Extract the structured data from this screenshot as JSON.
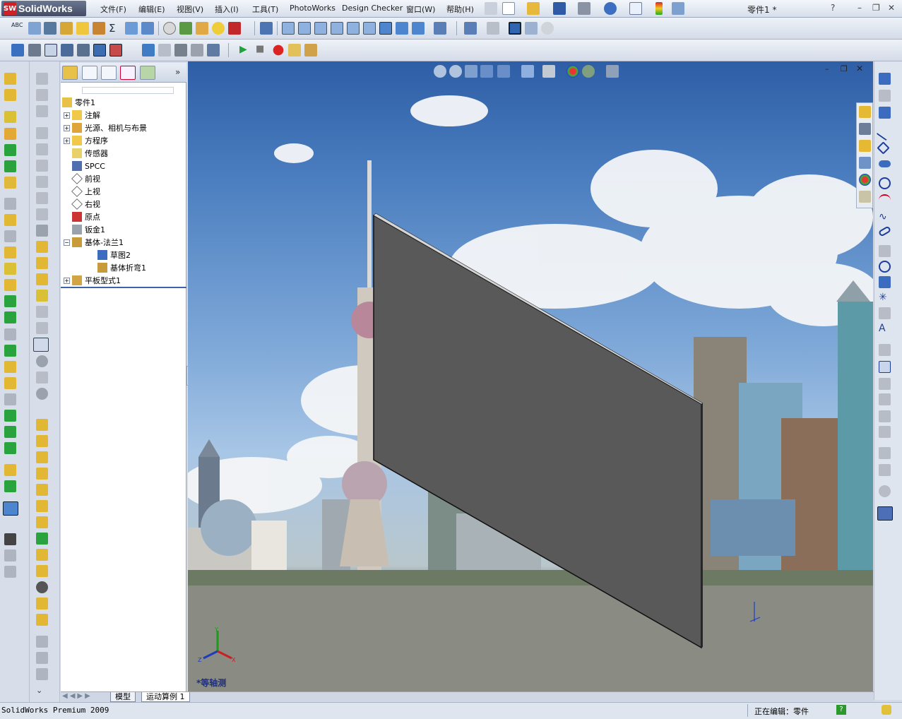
{
  "app": {
    "logo_mark": "SW",
    "logo_text": "SolidWorks"
  },
  "menu": {
    "items": [
      "文件(F)",
      "编辑(E)",
      "视图(V)",
      "插入(I)",
      "工具(T)",
      "PhotoWorks",
      "Design Checker",
      "窗口(W)",
      "帮助(H)"
    ]
  },
  "document": {
    "title": "零件1 *"
  },
  "window_controls": {
    "help": "?",
    "minimize": "–",
    "restore": "❐",
    "close": "✕"
  },
  "toolbar1": {
    "spelling_label": "ABC"
  },
  "feature_manager": {
    "search_placeholder": "",
    "root": "零件1",
    "tree": [
      {
        "label": "注解",
        "icon": "annotation-icon",
        "expand": "+"
      },
      {
        "label": "光源、相机与布景",
        "icon": "lights-camera-icon",
        "expand": "+"
      },
      {
        "label": "方程序",
        "icon": "equation-icon",
        "expand": "+"
      },
      {
        "label": "传感器",
        "icon": "sensor-icon",
        "expand": ""
      },
      {
        "label": "SPCC",
        "icon": "material-icon",
        "expand": ""
      },
      {
        "label": "前视",
        "icon": "plane-icon",
        "expand": ""
      },
      {
        "label": "上视",
        "icon": "plane-icon",
        "expand": ""
      },
      {
        "label": "右视",
        "icon": "plane-icon",
        "expand": ""
      },
      {
        "label": "原点",
        "icon": "origin-icon",
        "expand": ""
      },
      {
        "label": "钣金1",
        "icon": "sheetmetal-icon",
        "expand": ""
      },
      {
        "label": "基体-法兰1",
        "icon": "base-flange-icon",
        "expand": "−"
      },
      {
        "label": "草图2",
        "icon": "sketch-icon",
        "expand": "",
        "indent": 2
      },
      {
        "label": "基体折弯1",
        "icon": "base-bend-icon",
        "expand": "",
        "indent": 2
      },
      {
        "label": "平板型式1",
        "icon": "flat-pattern-icon",
        "expand": "+"
      }
    ]
  },
  "graphics": {
    "view_label": "*等轴测",
    "triad_labels": {
      "x": "X",
      "y": "Y",
      "z": "Z"
    }
  },
  "bottom_tabs": [
    "模型",
    "运动算例 1"
  ],
  "status": {
    "left": "SolidWorks Premium 2009",
    "right": "正在编辑：零件",
    "help": "?"
  },
  "colors": {
    "accent": "#3d63a8",
    "part_face": "#595959",
    "sky_top": "#2e5ea6",
    "water": "#8a8b83"
  }
}
